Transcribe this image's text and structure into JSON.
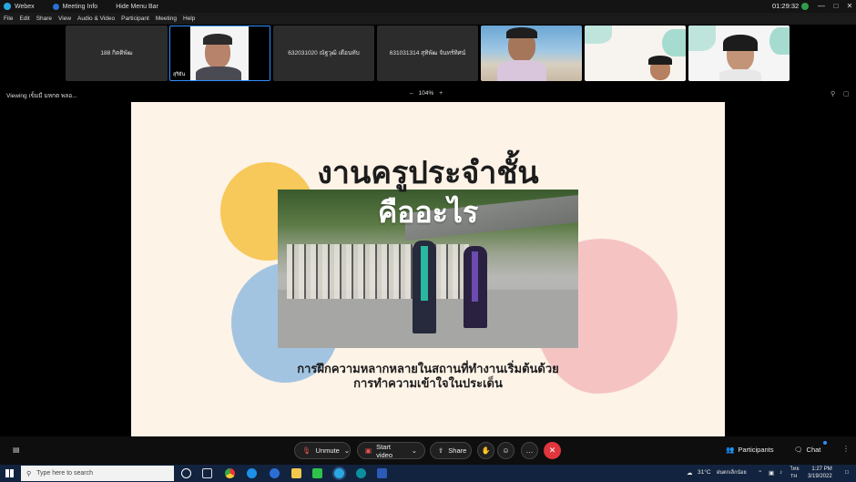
{
  "titlebar": {
    "app_name": "Webex",
    "meeting_info": "Meeting Info",
    "hide_menu": "Hide Menu Bar",
    "timer": "01:29:32",
    "min": "—",
    "max": "□",
    "close": "✕"
  },
  "menu": [
    "File",
    "Edit",
    "Share",
    "View",
    "Audio & Video",
    "Participant",
    "Meeting",
    "Help"
  ],
  "participants": [
    {
      "name": "188 กิตติพัฒ",
      "type": "name"
    },
    {
      "name": "สุริยัน",
      "type": "video"
    },
    {
      "name": "632031020 ณัฐวุฒิ เดือนทับ",
      "type": "name"
    },
    {
      "name": "631031314 สุทิพัฒ จันทร์ทิศน์",
      "type": "name"
    },
    {
      "name": "",
      "type": "video"
    },
    {
      "name": "",
      "type": "video"
    },
    {
      "name": "",
      "type": "video"
    }
  ],
  "viewbar": {
    "viewing": "Viewing เข็มมี มหกต พลอ...",
    "zoom_minus": "–",
    "zoom_level": "104%",
    "zoom_plus": "+"
  },
  "slide": {
    "title_line1": "งานครูประจำชั้น",
    "title_line2": "คืออะไร",
    "subtitle_line1": "การฝึกความหลากหลายในสถานที่ทำงานเริ่มต้นด้วย",
    "subtitle_line2": "การทำความเข้าใจในประเด็น"
  },
  "controls": {
    "unmute": "Unmute",
    "start_video": "Start video",
    "share": "Share",
    "more": "…",
    "leave": "✕",
    "participants": "Participants",
    "chat": "Chat"
  },
  "taskbar": {
    "search_placeholder": "Type here to search",
    "weather": "31°C",
    "weather_text": "ฝนตกเล็กน้อย",
    "lang": "ไทย",
    "lang2": "TH",
    "time": "1:27 PM",
    "date": "3/19/2022"
  },
  "colors": {
    "accent": "#2f8fff",
    "leave": "#e0363d",
    "yellow_blob": "#f7c85a",
    "blue_blob": "#a3c4e1",
    "pink_blob": "#f6c3c3"
  }
}
